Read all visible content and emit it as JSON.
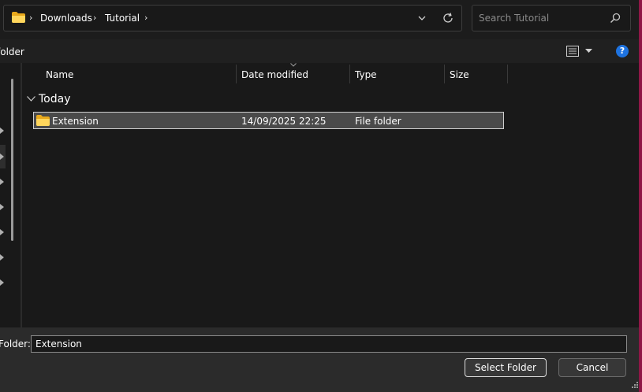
{
  "address_bar": {
    "breadcrumbs": [
      "Downloads",
      "Tutorial"
    ],
    "folder_icon": "folder-icon",
    "dropdown_icon": "chevron-down-icon",
    "refresh_icon": "refresh-icon"
  },
  "search": {
    "placeholder": "Search Tutorial",
    "icon": "search-icon"
  },
  "command_bar": {
    "new_folder_label": "New folder",
    "visible_new_folder_text": "folder",
    "view_icon": "view-details-icon",
    "help_label": "?"
  },
  "columns": [
    "Name",
    "Date modified",
    "Type",
    "Size"
  ],
  "groups": [
    {
      "label": "Today",
      "items": [
        {
          "name": "Extension",
          "date_modified": "14/09/2025 22:25",
          "type": "File folder",
          "size": ""
        }
      ]
    }
  ],
  "footer": {
    "folder_label": "Folder:",
    "folder_value": "Extension",
    "select_button": "Select Folder",
    "cancel_button": "Cancel"
  },
  "colors": {
    "background": "#191919",
    "accent_folder": "#f4c542",
    "help_blue": "#1e73e0",
    "side_strip": "#8e1746"
  }
}
